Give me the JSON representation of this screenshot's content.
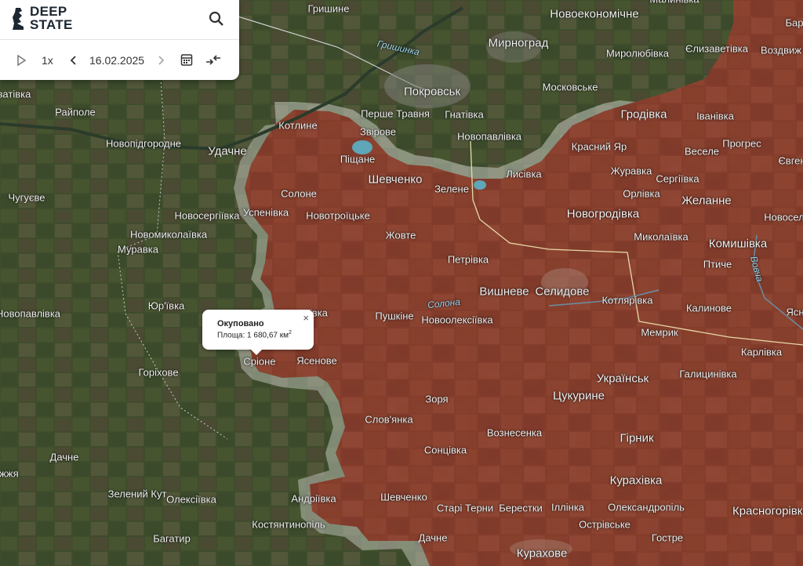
{
  "app": {
    "logo_line1": "DEEP",
    "logo_line2": "STATE"
  },
  "toolbar": {
    "play_icon": "play-icon",
    "speed": "1x",
    "prev_icon": "chevron-left-icon",
    "date": "16.02.2025",
    "next_icon": "chevron-right-icon",
    "calendar_icon": "calendar-icon",
    "compare_icon": "compare-arrows-icon",
    "search_icon": "search-icon"
  },
  "popup": {
    "title": "Окуповано",
    "area_label": "Площа: 1 680,67 км",
    "area_sup": "2",
    "close": "×"
  },
  "colors": {
    "occupied": "#8a3b2b",
    "contested": "#b9c0b0",
    "terrain": "#3f4d2d",
    "panel_bg": "#ffffff"
  },
  "places": [
    {
      "name": "Гришине",
      "type": "town"
    },
    {
      "name": "Новоекономічне",
      "type": "city"
    },
    {
      "name": "Малинівка",
      "type": "town"
    },
    {
      "name": "Бар",
      "type": "town"
    },
    {
      "name": "Гришинка",
      "type": "water"
    },
    {
      "name": "Мирноград",
      "type": "city"
    },
    {
      "name": "Миролюбівка",
      "type": "town"
    },
    {
      "name": "Єлизаветівка",
      "type": "town"
    },
    {
      "name": "Воздвиж",
      "type": "town"
    },
    {
      "name": "Покровськ",
      "type": "city"
    },
    {
      "name": "Московське",
      "type": "town"
    },
    {
      "name": "Перше Травня",
      "type": "town"
    },
    {
      "name": "Гнатівка",
      "type": "town"
    },
    {
      "name": "Котлине",
      "type": "town"
    },
    {
      "name": "Звірове",
      "type": "town"
    },
    {
      "name": "Новопавлівка",
      "type": "town"
    },
    {
      "name": "Гродівка",
      "type": "city"
    },
    {
      "name": "Іванівка",
      "type": "town"
    },
    {
      "name": "Райполе",
      "type": "town"
    },
    {
      "name": "ватівка",
      "type": "town"
    },
    {
      "name": "Новопідгородне",
      "type": "town"
    },
    {
      "name": "Удачне",
      "type": "city"
    },
    {
      "name": "Піщане",
      "type": "town"
    },
    {
      "name": "Красний Яр",
      "type": "town"
    },
    {
      "name": "Веселе",
      "type": "town"
    },
    {
      "name": "Прогрес",
      "type": "town"
    },
    {
      "name": "Євген",
      "type": "town"
    },
    {
      "name": "Шевченко",
      "type": "city"
    },
    {
      "name": "Лисівка",
      "type": "town"
    },
    {
      "name": "Журавка",
      "type": "town"
    },
    {
      "name": "Сергіївка",
      "type": "town"
    },
    {
      "name": "Зелене",
      "type": "town"
    },
    {
      "name": "Орлівка",
      "type": "town"
    },
    {
      "name": "Чугуєве",
      "type": "town"
    },
    {
      "name": "Солоне",
      "type": "town"
    },
    {
      "name": "Желанне",
      "type": "city"
    },
    {
      "name": "Новосергіївка",
      "type": "town"
    },
    {
      "name": "Успенівка",
      "type": "town"
    },
    {
      "name": "Новотроїцьке",
      "type": "town"
    },
    {
      "name": "Новогродівка",
      "type": "city"
    },
    {
      "name": "Новосел",
      "type": "town"
    },
    {
      "name": "Новомиколаївка",
      "type": "town"
    },
    {
      "name": "Жовте",
      "type": "town"
    },
    {
      "name": "Миколаївка",
      "type": "town"
    },
    {
      "name": "Комишівка",
      "type": "city"
    },
    {
      "name": "Муравка",
      "type": "town"
    },
    {
      "name": "Петрівка",
      "type": "town"
    },
    {
      "name": "Вовча",
      "type": "water"
    },
    {
      "name": "Птиче",
      "type": "town"
    },
    {
      "name": "Вишневе",
      "type": "city"
    },
    {
      "name": "Селидове",
      "type": "city"
    },
    {
      "name": "Котлярівка",
      "type": "town"
    },
    {
      "name": "Юр'ївка",
      "type": "town"
    },
    {
      "name": "Солона",
      "type": "water"
    },
    {
      "name": "Калинове",
      "type": "town"
    },
    {
      "name": "Ясн",
      "type": "town"
    },
    {
      "name": "Новопавлівка",
      "type": "town"
    },
    {
      "name": "ївка",
      "type": "town"
    },
    {
      "name": "Пушкіне",
      "type": "town"
    },
    {
      "name": "Новоолексіївка",
      "type": "town"
    },
    {
      "name": "Мемрик",
      "type": "town"
    },
    {
      "name": "Карлівка",
      "type": "town"
    },
    {
      "name": "Сріоне",
      "type": "town"
    },
    {
      "name": "Ясенове",
      "type": "town"
    },
    {
      "name": "Горіхове",
      "type": "town"
    },
    {
      "name": "Українськ",
      "type": "city"
    },
    {
      "name": "Галицинівка",
      "type": "town"
    },
    {
      "name": "Цукурине",
      "type": "city"
    },
    {
      "name": "Зоря",
      "type": "town"
    },
    {
      "name": "Слов'янка",
      "type": "town"
    },
    {
      "name": "Вознесенка",
      "type": "town"
    },
    {
      "name": "Гірник",
      "type": "city"
    },
    {
      "name": "Сонцівка",
      "type": "town"
    },
    {
      "name": "Дачне",
      "type": "town"
    },
    {
      "name": "іжжя",
      "type": "town"
    },
    {
      "name": "Курахівка",
      "type": "city"
    },
    {
      "name": "Зелений Кут",
      "type": "town"
    },
    {
      "name": "Олексіївка",
      "type": "town"
    },
    {
      "name": "Андріївка",
      "type": "town"
    },
    {
      "name": "Шевченко",
      "type": "town"
    },
    {
      "name": "Старі Терни",
      "type": "town"
    },
    {
      "name": "Берестки",
      "type": "town"
    },
    {
      "name": "Іллінка",
      "type": "town"
    },
    {
      "name": "Олександропіль",
      "type": "town"
    },
    {
      "name": "Красногорівка",
      "type": "city"
    },
    {
      "name": "Костянтинопіль",
      "type": "town"
    },
    {
      "name": "Острівське",
      "type": "town"
    },
    {
      "name": "Багатир",
      "type": "town"
    },
    {
      "name": "Дачне",
      "type": "town"
    },
    {
      "name": "Гостре",
      "type": "town"
    },
    {
      "name": "Курахове",
      "type": "city"
    }
  ]
}
